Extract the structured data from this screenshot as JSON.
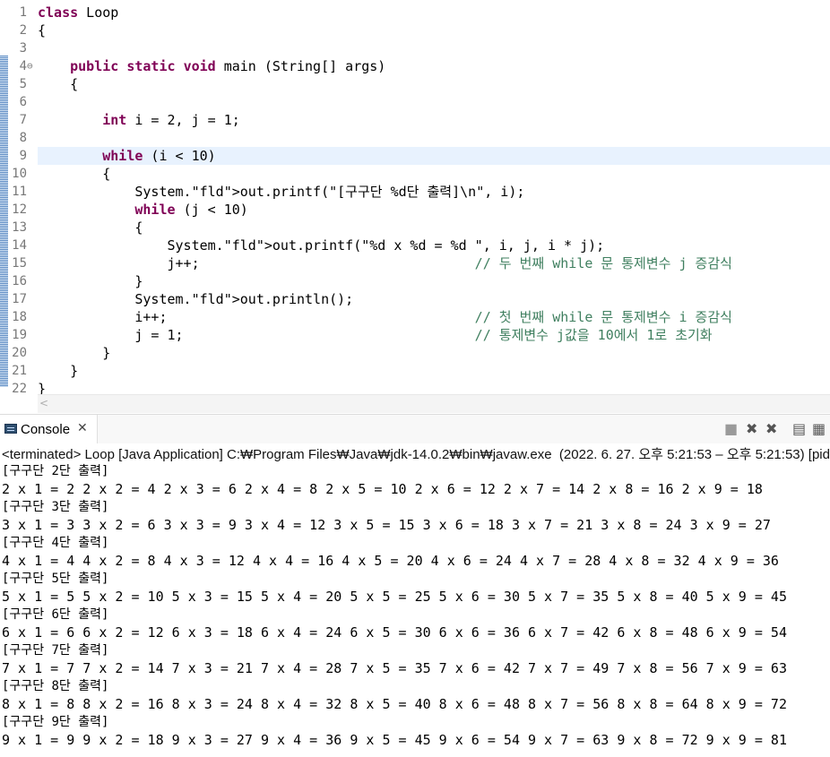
{
  "editor": {
    "lines": [
      {
        "n": "1",
        "code": "class Loop",
        "type": "class"
      },
      {
        "n": "2",
        "code": "{",
        "type": "plain"
      },
      {
        "n": "3",
        "code": "",
        "type": "plain"
      },
      {
        "n": "4",
        "code": "    public static void main (String[] args)",
        "type": "main"
      },
      {
        "n": "5",
        "code": "    {",
        "type": "plain"
      },
      {
        "n": "6",
        "code": "",
        "type": "plain"
      },
      {
        "n": "7",
        "code": "        int i = 2, j = 1;",
        "type": "int"
      },
      {
        "n": "8",
        "code": "",
        "type": "plain"
      },
      {
        "n": "9",
        "code": "        while (i < 10)",
        "type": "while"
      },
      {
        "n": "10",
        "code": "        {",
        "type": "plain"
      },
      {
        "n": "11",
        "code": "            System.out.printf(\"[구구단 %d단 출력]\\n\", i);",
        "type": "printf1"
      },
      {
        "n": "12",
        "code": "            while (j < 10)",
        "type": "while"
      },
      {
        "n": "13",
        "code": "            {",
        "type": "plain"
      },
      {
        "n": "14",
        "code": "                System.out.printf(\"%d x %d = %d \", i, j, i * j);",
        "type": "printf2"
      },
      {
        "n": "15",
        "code": "                j++;                                  // 두 번째 while 문 통제변수 j 증감식",
        "type": "comment"
      },
      {
        "n": "16",
        "code": "            }",
        "type": "plain"
      },
      {
        "n": "17",
        "code": "            System.out.println();",
        "type": "println"
      },
      {
        "n": "18",
        "code": "            i++;                                      // 첫 번째 while 문 통제변수 i 증감식",
        "type": "comment"
      },
      {
        "n": "19",
        "code": "            j = 1;                                    // 통제변수 j값을 10에서 1로 초기화",
        "type": "comment"
      },
      {
        "n": "20",
        "code": "        }",
        "type": "plain"
      },
      {
        "n": "21",
        "code": "    }",
        "type": "plain"
      },
      {
        "n": "22",
        "code": "}",
        "type": "plain"
      }
    ]
  },
  "scroll_left_glyph": "<",
  "console": {
    "tab_label": "Console",
    "tab_close": "✕",
    "toolbar": [
      "■",
      "✖",
      "✖",
      "▤",
      "▦"
    ],
    "terminated": "<terminated> Loop [Java Application] C:₩Program Files₩Java₩jdk-14.0.2₩bin₩javaw.exe  (2022. 6. 27. 오후 5:21:53 – 오후 5:21:53) [pid: ",
    "output": [
      "[구구단 2단 출력]",
      "2 x 1 = 2 2 x 2 = 4 2 x 3 = 6 2 x 4 = 8 2 x 5 = 10 2 x 6 = 12 2 x 7 = 14 2 x 8 = 16 2 x 9 = 18",
      "[구구단 3단 출력]",
      "3 x 1 = 3 3 x 2 = 6 3 x 3 = 9 3 x 4 = 12 3 x 5 = 15 3 x 6 = 18 3 x 7 = 21 3 x 8 = 24 3 x 9 = 27",
      "[구구단 4단 출력]",
      "4 x 1 = 4 4 x 2 = 8 4 x 3 = 12 4 x 4 = 16 4 x 5 = 20 4 x 6 = 24 4 x 7 = 28 4 x 8 = 32 4 x 9 = 36",
      "[구구단 5단 출력]",
      "5 x 1 = 5 5 x 2 = 10 5 x 3 = 15 5 x 4 = 20 5 x 5 = 25 5 x 6 = 30 5 x 7 = 35 5 x 8 = 40 5 x 9 = 45",
      "[구구단 6단 출력]",
      "6 x 1 = 6 6 x 2 = 12 6 x 3 = 18 6 x 4 = 24 6 x 5 = 30 6 x 6 = 36 6 x 7 = 42 6 x 8 = 48 6 x 9 = 54",
      "[구구단 7단 출력]",
      "7 x 1 = 7 7 x 2 = 14 7 x 3 = 21 7 x 4 = 28 7 x 5 = 35 7 x 6 = 42 7 x 7 = 49 7 x 8 = 56 7 x 9 = 63",
      "[구구단 8단 출력]",
      "8 x 1 = 8 8 x 2 = 16 8 x 3 = 24 8 x 4 = 32 8 x 5 = 40 8 x 6 = 48 8 x 7 = 56 8 x 8 = 64 8 x 9 = 72",
      "[구구단 9단 출력]",
      "9 x 1 = 9 9 x 2 = 18 9 x 3 = 27 9 x 4 = 36 9 x 5 = 45 9 x 6 = 54 9 x 7 = 63 9 x 8 = 72 9 x 9 = 81"
    ]
  }
}
